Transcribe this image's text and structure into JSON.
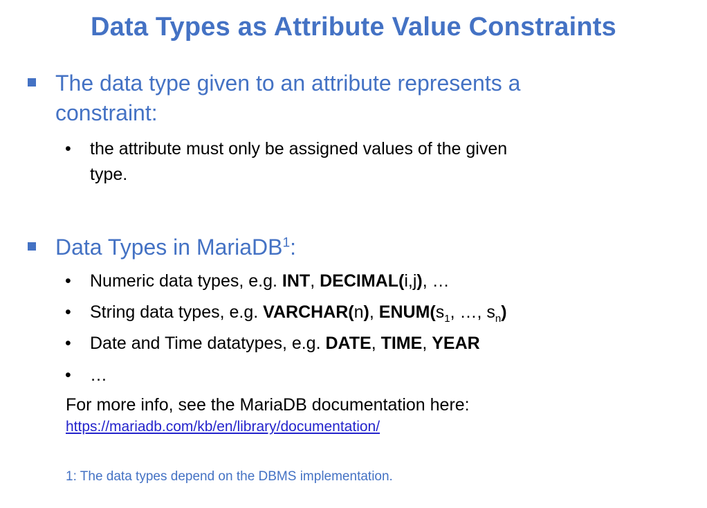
{
  "title": "Data Types as Attribute Value Constraints",
  "bullet1": {
    "text_line1": "The data type given to an attribute represents a",
    "text_line2": "constraint:",
    "sub": {
      "line1": "the attribute must only be assigned values of the given",
      "line2": "type."
    }
  },
  "bullet2": {
    "text": "Data Types in MariaDB",
    "sup": "1",
    "colon": ":",
    "items": {
      "numeric": {
        "prefix": "Numeric data types, e.g. ",
        "int": "INT",
        "comma": ", ",
        "decimal": "DECIMAL(",
        "decimal_args": "i,j",
        "decimal_close": ")",
        "suffix": ", …"
      },
      "string": {
        "prefix": "String data types, e.g. ",
        "varchar": "VARCHAR(",
        "varchar_arg": "n",
        "varchar_close": ")",
        "comma": ", ",
        "enum": "ENUM(",
        "s1": "s",
        "s1_sub": "1",
        "mid": ", …, ",
        "sn": "s",
        "sn_sub": "n",
        "enum_close": ")"
      },
      "date": {
        "prefix": "Date and Time datatypes, e.g. ",
        "date": "DATE",
        "c1": ", ",
        "time": "TIME",
        "c2": ", ",
        "year": "YEAR"
      },
      "ellipsis": "…"
    }
  },
  "info": "For more info, see the MariaDB documentation here:",
  "link": "https://mariadb.com/kb/en/library/documentation/",
  "footnote": "1:  The data types depend on the DBMS implementation.",
  "colors": {
    "accent": "#4472C4",
    "link": "#2424CC"
  }
}
